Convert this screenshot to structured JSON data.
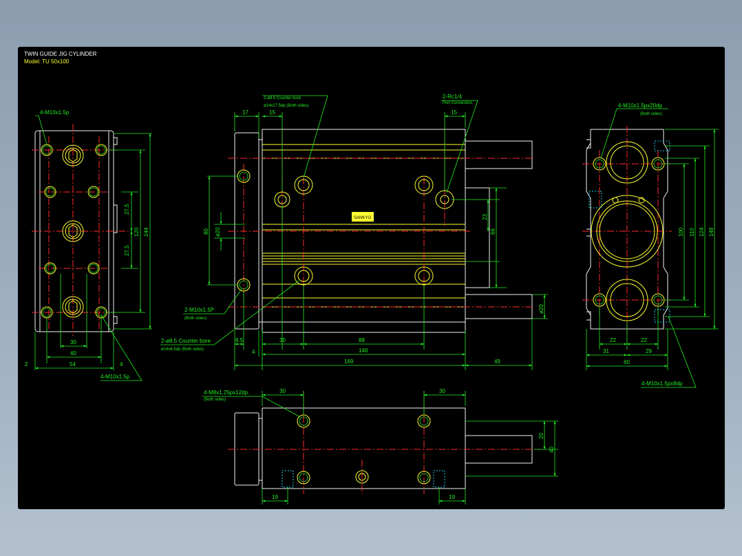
{
  "title": "TWIN GUIDE JIG CYLINDER",
  "model": "Model: TU  50x100",
  "colors": {
    "outline": "#f4f4f4",
    "detail": "#ffff33",
    "dimension": "#22ee22",
    "centerline": "#ff2a2a",
    "hidden": "#22ccee",
    "background": "#000000"
  },
  "left_view": {
    "callout_top": "4-M10x1.5p",
    "callout_bottom": "4-M10x1.5p",
    "dims": {
      "d275a": "27.5",
      "d275b": "27.5",
      "d120": "120",
      "d144": "144",
      "d30": "30",
      "d40": "40",
      "d54": "54",
      "d2": "2",
      "d4": "4"
    }
  },
  "front_view": {
    "callout_cbore_top": "2-ø8.5 Counter bore",
    "callout_cbore_top_sub": "ø14x17.5dp (Both sides)",
    "callout_port": "2-Rc1/4",
    "callout_port_sub": "Port Connection",
    "callout_tap": "2-M10x1.5P",
    "callout_tap_sub": "(Both sides)",
    "callout_cbore_bottom": "2-ø8.5 Counter bore",
    "callout_cbore_bottom_sub": "ø14x6.5dp (Both sides)",
    "label_plate": "SANKYO",
    "dims": {
      "d17": "17",
      "d15a": "15",
      "d15b": "15",
      "d80": "80",
      "d20": "ø20",
      "d23": "23",
      "d66": "66",
      "d20rod": "ø20",
      "d85": "8.5",
      "d4": "4",
      "d30": "30",
      "d88": "88",
      "d148": "148",
      "d169": "169",
      "d49": "49"
    }
  },
  "right_view": {
    "callout_top": "4-M10x1.5px20dp",
    "callout_top_sub": "(Both sides)",
    "callout_bottom": "4-M10x1.5px8dp",
    "dims": {
      "d100": "100",
      "d110": "110",
      "d124": "124",
      "d148": "148",
      "d22a": "22",
      "d22b": "22",
      "d31": "31",
      "d29": "29",
      "d60": "60"
    }
  },
  "bottom_view": {
    "callout": "4-M8x1.25px12dp.",
    "callout_sub": "(Both sides)",
    "dims": {
      "d30a": "30",
      "d30b": "30",
      "d20": "20",
      "d40": "40",
      "d19a": "19",
      "d19b": "19"
    }
  }
}
